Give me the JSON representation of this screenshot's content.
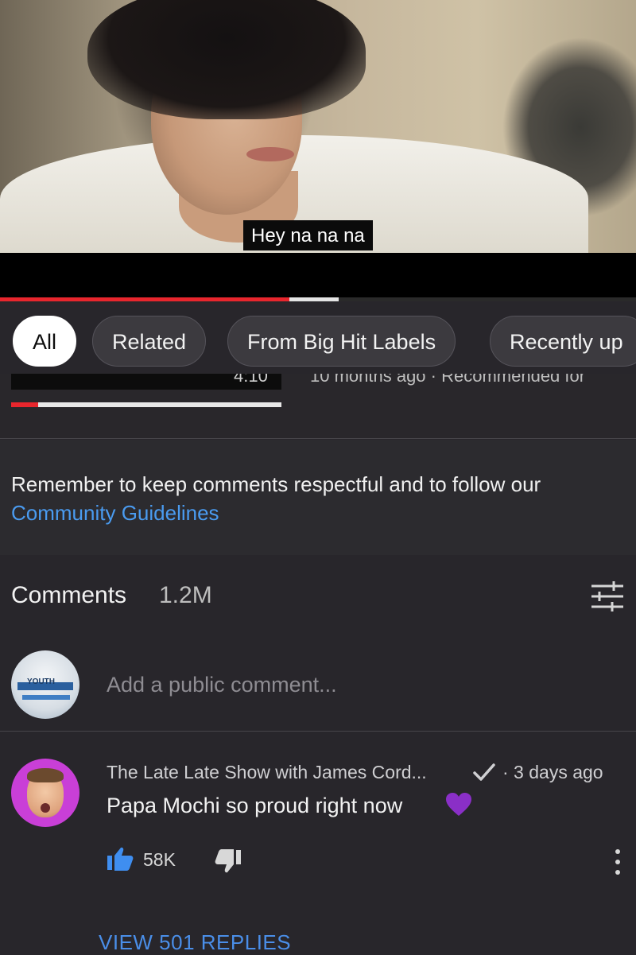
{
  "video": {
    "subtitle": "Hey na na na",
    "progress_played": 0.455,
    "progress_buffered": 0.532,
    "progress_color": "#e8262d"
  },
  "chips": [
    {
      "label": "All",
      "active": true
    },
    {
      "label": "Related",
      "active": false
    },
    {
      "label": "From Big Hit Labels",
      "active": false
    },
    {
      "label": "Recently up",
      "active": false
    }
  ],
  "previous_item": {
    "duration_partial": "4:10",
    "meta_partial": "10 months ago · Recommended for",
    "watched_fraction": 0.1
  },
  "guidelines": {
    "text": "Remember to keep comments respectful and to follow our ",
    "link": "Community Guidelines"
  },
  "comments": {
    "title": "Comments",
    "count": "1.2M",
    "sort_icon": "sort-filter-icon",
    "add_placeholder": "Add a public comment...",
    "my_avatar_label": "YOUTH"
  },
  "top_comment": {
    "author": "The Late Late Show with James Cord...",
    "verified_icon": "checkmark-icon",
    "time": "· 3 days ago",
    "text": "Papa Mochi so proud right now",
    "emoji_icon": "purple-heart-icon",
    "likes": "58K",
    "replies_label": "VIEW 501 REPLIES",
    "accent": "#4a8ee8",
    "avatar_bg": "#c93fd7"
  }
}
